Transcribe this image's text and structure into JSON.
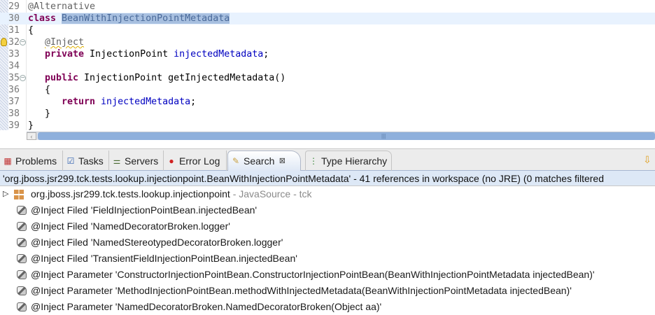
{
  "editor": {
    "lines": [
      {
        "n": "29"
      },
      {
        "n": "30"
      },
      {
        "n": "31"
      },
      {
        "n": "32"
      },
      {
        "n": "33"
      },
      {
        "n": "34"
      },
      {
        "n": "35"
      },
      {
        "n": "36"
      },
      {
        "n": "37"
      },
      {
        "n": "38"
      },
      {
        "n": "39"
      }
    ],
    "tokens": {
      "alt": "@Alternative",
      "class_kw": "class ",
      "class_name": "BeanWithInjectionPointMetadata",
      "brace_open": "{",
      "brace_close": "}",
      "inject": "@Inject",
      "private_kw": "private",
      "type": " InjectionPoint ",
      "field": "injectedMetadata",
      "semi": ";",
      "public_kw": "public",
      "method": " InjectionPoint getInjectedMetadata()",
      "return_kw": "return",
      "ret_field": " injectedMetadata",
      "ret_semi": ";"
    }
  },
  "tabs": [
    {
      "label": "Problems",
      "icon": "problems-icon"
    },
    {
      "label": "Tasks",
      "icon": "tasks-icon"
    },
    {
      "label": "Servers",
      "icon": "servers-icon"
    },
    {
      "label": "Error Log",
      "icon": "error-log-icon"
    },
    {
      "label": "Search",
      "icon": "search-icon",
      "active": true
    },
    {
      "label": "Type Hierarchy",
      "icon": "type-hierarchy-icon"
    }
  ],
  "status": "'org.jboss.jsr299.tck.tests.lookup.injectionpoint.BeanWithInjectionPointMetadata' - 41 references in workspace (no JRE) (0 matches filtered",
  "tree": {
    "package": {
      "name": "org.jboss.jsr299.tck.tests.lookup.injectionpoint",
      "meta": " - JavaSource - tck"
    },
    "items": [
      "@Inject Filed 'FieldInjectionPointBean.injectedBean'",
      "@Inject Filed 'NamedDecoratorBroken.logger'",
      "@Inject Filed 'NamedStereotypedDecoratorBroken.logger'",
      "@Inject Filed 'TransientFieldInjectionPointBean.injectedBean'",
      "@Inject Parameter 'ConstructorInjectionPointBean.ConstructorInjectionPointBean(BeanWithInjectionPointMetadata injectedBean)'",
      "@Inject Parameter 'MethodInjectionPointBean.methodWithInjectedMetadata(BeanWithInjectionPointMetadata injectedBean)'",
      "@Inject Parameter 'NamedDecoratorBroken.NamedDecoratorBroken(Object aa)'"
    ]
  }
}
